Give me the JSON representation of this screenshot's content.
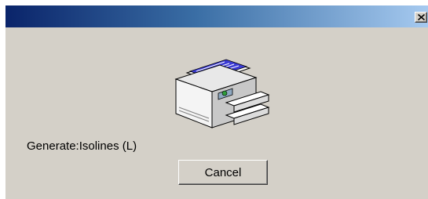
{
  "window": {
    "title": "",
    "close_icon": "close-icon"
  },
  "icon": "printer-icon",
  "status": {
    "text": "Generate:Isolines (L)"
  },
  "buttons": {
    "cancel_label": "Cancel"
  },
  "colors": {
    "title_gradient_start": "#0a246a",
    "title_gradient_end": "#a6caf0",
    "dialog_background": "#d4d0c8"
  }
}
